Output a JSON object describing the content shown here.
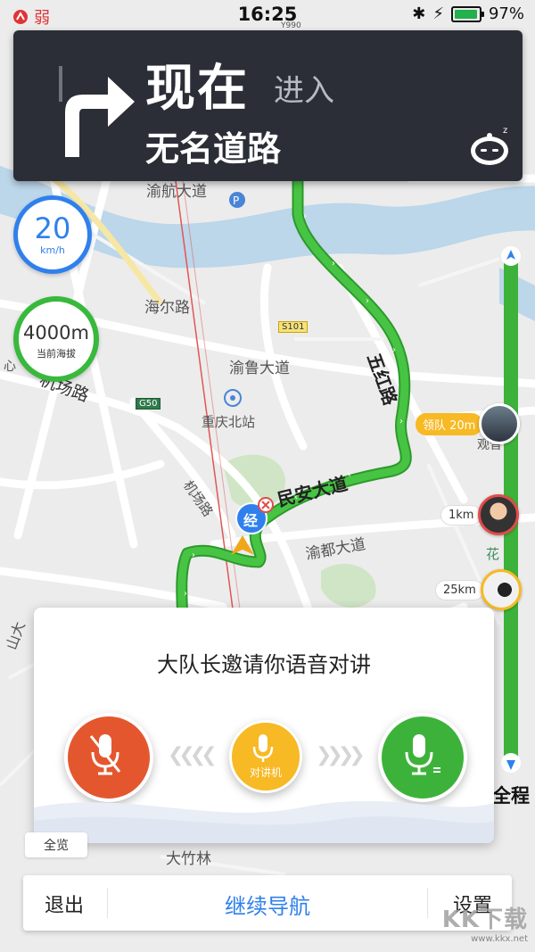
{
  "status_bar": {
    "signal_label": "弱",
    "time": "16:25",
    "battery_pct": "97%",
    "battery_level": 0.97
  },
  "guidance": {
    "now": "现在",
    "action": "进入",
    "road": "无名道路",
    "turn_icon": "turn-right-arrow-icon"
  },
  "speed": {
    "value": "20",
    "unit": "km/h"
  },
  "altitude": {
    "value": "4000m",
    "label": "当前海拔"
  },
  "map_labels": {
    "yuhang": "渝航大道",
    "haier": "海尔路",
    "s101": "S101",
    "yulu": "渝鲁大道",
    "jichang": "机场路",
    "g50": "G50",
    "chongqing_north": "重庆北站",
    "jichang2": "机场路",
    "minan": "民安大道",
    "wuhong": "五红路",
    "yudu": "渝都大道",
    "dazhulin": "大竹林",
    "guan": "观音",
    "hua": "花",
    "y990": "Y990",
    "jing": "经",
    "xin": "心",
    "shan": "山大"
  },
  "team": [
    {
      "tag": "领队 20m"
    },
    {
      "tag": "1km"
    },
    {
      "tag": "25km"
    }
  ],
  "progress": {
    "label": "全程"
  },
  "invite": {
    "title": "大队长邀请你语音对讲",
    "walkie_label": "对讲机"
  },
  "overview_button": "全览",
  "bottom": {
    "exit": "退出",
    "continue": "继续导航",
    "settings": "设置"
  },
  "watermark": {
    "text": "KK下载",
    "url": "www.kkx.net"
  },
  "colors": {
    "accent": "#2f80ed",
    "route": "#3db23a",
    "decline": "#e4572e",
    "walkie": "#f7b924"
  }
}
